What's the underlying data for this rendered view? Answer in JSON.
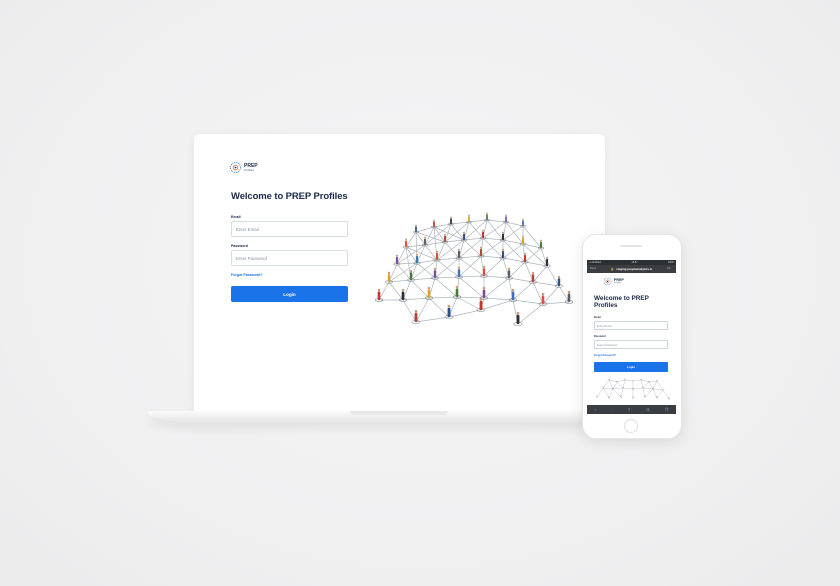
{
  "laptop": {
    "logo": {
      "name": "PREP",
      "sub": "Profiles"
    },
    "title": "Welcome to PREP Profiles",
    "email": {
      "label": "Email",
      "placeholder": "Enter Email"
    },
    "password": {
      "label": "Password",
      "placeholder": "Enter Password"
    },
    "forgot": "Forgot Password?",
    "login": "Login"
  },
  "phone": {
    "status": {
      "carrier": "••• AirAlbert",
      "time": "16:57",
      "battery": "100%"
    },
    "url": "staging.peopleanalytics.io",
    "url_left": "Done",
    "url_right": "AA",
    "logo": {
      "name": "PREP",
      "sub": "Profiles"
    },
    "title": "Welcome to PREP Profiles",
    "email": {
      "label": "Email",
      "placeholder": "Enter Email"
    },
    "password": {
      "label": "Password",
      "placeholder": "Enter Password"
    },
    "forgot": "Forgot Password?",
    "login": "Login"
  },
  "icons": [
    "logo-icon",
    "lock-icon",
    "back-icon",
    "forward-icon",
    "share-icon",
    "bookmarks-icon",
    "tabs-icon"
  ],
  "colors": {
    "primary": "#1a73e8",
    "heading": "#1a2a48",
    "link": "#1f6fe6"
  }
}
